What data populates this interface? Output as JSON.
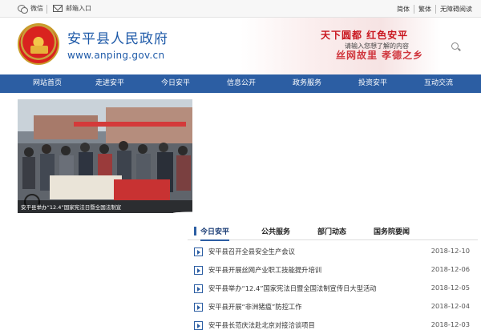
{
  "topbar": {
    "wechat_label": "微信",
    "mail_label": "邮箱入口",
    "links": [
      "简体",
      "繁体",
      "无障碍阅读"
    ]
  },
  "header": {
    "site_title": "安平县人民政府",
    "site_url": "www.anping.gov.cn",
    "slogan_line1": "天下圆都 红色安平",
    "slogan_line2": "丝网故里 孝德之乡",
    "search_placeholder": "请输入您想了解的内容"
  },
  "nav": [
    "网站首页",
    "走进安平",
    "今日安平",
    "信息公开",
    "政务服务",
    "投资安平",
    "互动交流"
  ],
  "carousel": {
    "caption": "安平县举办“12.4”国家宪法日暨全国法制宣",
    "slide_count": 3
  },
  "news": {
    "tabs": [
      "今日安平",
      "公共服务",
      "部门动态",
      "国务院要闻"
    ],
    "active_tab": "今日安平",
    "items": [
      {
        "title": "安平县召开全县安全生产会议",
        "date": "2018-12-10"
      },
      {
        "title": "安平县开展丝网产业职工技能提升培训",
        "date": "2018-12-06"
      },
      {
        "title": "安平县举办“12.4”国家宪法日暨全国法制宣传日大型活动",
        "date": "2018-12-05"
      },
      {
        "title": "安平县开展“非洲猪瘟”防控工作",
        "date": "2018-12-04"
      },
      {
        "title": "安平县长范庆法赴北京对接洽谈项目",
        "date": "2018-12-03"
      }
    ]
  },
  "colors": {
    "brand_blue": "#2c5ea3",
    "title_blue": "#1d59a8",
    "slogan_red": "#c9161f"
  }
}
